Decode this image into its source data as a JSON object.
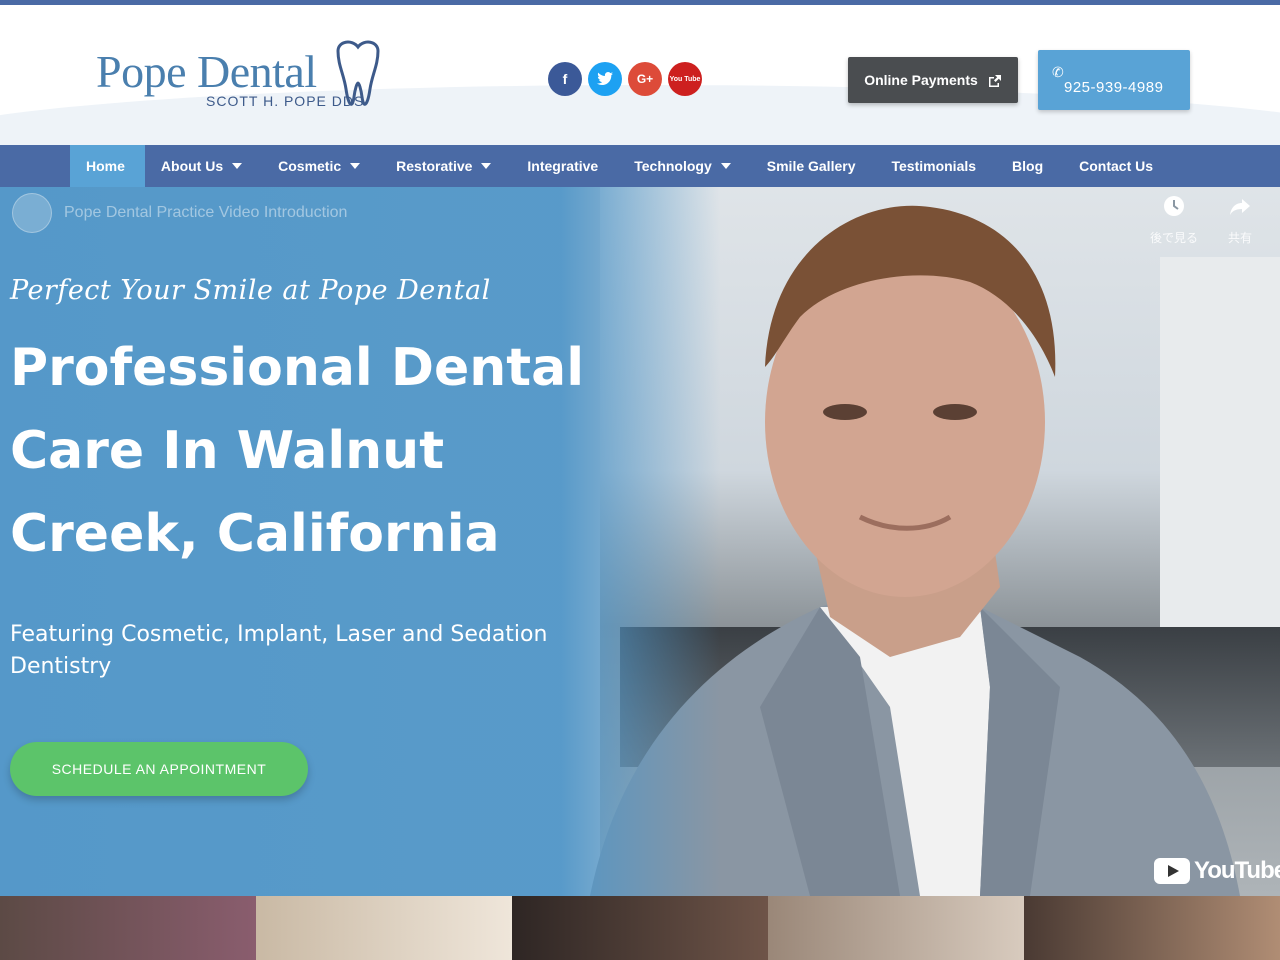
{
  "brand": {
    "logo_main": "Pope Dental",
    "logo_sub": "SCOTT H. POPE DDS"
  },
  "social": [
    {
      "name": "facebook",
      "glyph": "f",
      "color": "#3b5998"
    },
    {
      "name": "twitter",
      "glyph": "t",
      "color": "#1da1f2"
    },
    {
      "name": "google-plus",
      "glyph": "G+",
      "color": "#dd4b39"
    },
    {
      "name": "youtube",
      "glyph": "You Tube",
      "color": "#cd201f"
    }
  ],
  "header": {
    "payments_label": "Online Payments",
    "phone": "925-939-4989"
  },
  "nav": {
    "items": [
      {
        "label": "Home",
        "active": true,
        "dropdown": false
      },
      {
        "label": "About Us",
        "active": false,
        "dropdown": true
      },
      {
        "label": "Cosmetic",
        "active": false,
        "dropdown": true
      },
      {
        "label": "Restorative",
        "active": false,
        "dropdown": true
      },
      {
        "label": "Integrative",
        "active": false,
        "dropdown": false
      },
      {
        "label": "Technology",
        "active": false,
        "dropdown": true
      },
      {
        "label": "Smile Gallery",
        "active": false,
        "dropdown": false
      },
      {
        "label": "Testimonials",
        "active": false,
        "dropdown": false
      },
      {
        "label": "Blog",
        "active": false,
        "dropdown": false
      },
      {
        "label": "Contact Us",
        "active": false,
        "dropdown": false
      }
    ]
  },
  "video": {
    "title": "Pope Dental Practice Video Introduction",
    "watch_later": "後で見る",
    "share": "共有",
    "brand": "YouTube"
  },
  "hero": {
    "script_line": "Perfect Your Smile at Pope Dental",
    "headline": "Professional Dental Care In Walnut Creek, California",
    "subline": "Featuring Cosmetic, Implant, Laser and Sedation Dentistry",
    "cta": "SCHEDULE AN APPOINTMENT"
  },
  "colors": {
    "nav_bg": "#4a6aa5",
    "accent": "#59a3d6",
    "cta": "#5cc46a"
  }
}
